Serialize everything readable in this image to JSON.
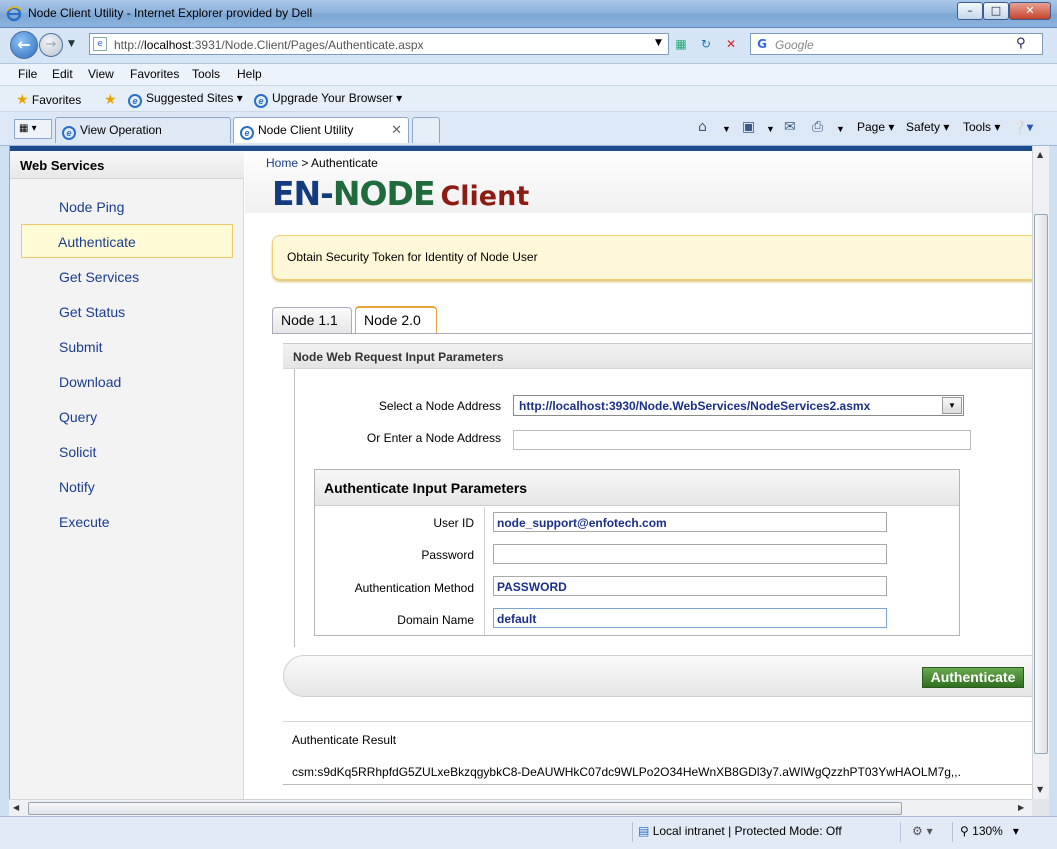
{
  "window": {
    "title": "Node Client Utility - Internet Explorer provided by Dell",
    "minimize": "–",
    "maximize": "□",
    "close": "✕"
  },
  "navbar": {
    "url_prefix": "http://",
    "url_host": "localhost",
    "url_rest": ":3931/Node.Client/Pages/Authenticate.aspx",
    "search_placeholder": "Google"
  },
  "menu": [
    "File",
    "Edit",
    "View",
    "Favorites",
    "Tools",
    "Help"
  ],
  "favorites_bar": {
    "favorites": "Favorites",
    "suggested": "Suggested Sites",
    "upgrade": "Upgrade Your Browser"
  },
  "browser_tabs": [
    {
      "label": "View Operation"
    },
    {
      "label": "Node Client Utility"
    }
  ],
  "command_bar": {
    "page": "Page",
    "safety": "Safety",
    "tools": "Tools"
  },
  "sidebar": {
    "title": "Web Services",
    "items": [
      "Node Ping",
      "Authenticate",
      "Get Services",
      "Get Status",
      "Submit",
      "Download",
      "Query",
      "Solicit",
      "Notify",
      "Execute"
    ],
    "active": "Authenticate"
  },
  "breadcrumb": {
    "home": "Home",
    "separator": ">",
    "current": "Authenticate"
  },
  "logo": {
    "en": "EN",
    "dash": "-",
    "node": "NODE",
    "client": "Client"
  },
  "banner": "Obtain Security Token for Identity of Node User",
  "page_tabs": [
    "Node 1.1",
    "Node 2.0"
  ],
  "active_page_tab": "Node 2.0",
  "request_panel": {
    "title": "Node Web Request Input Parameters",
    "select_label": "Select a Node Address",
    "select_value": "http://localhost:3930/Node.WebServices/NodeServices2.asmx",
    "enter_label": "Or Enter a Node Address",
    "enter_value": ""
  },
  "auth": {
    "title": "Authenticate Input Parameters",
    "user_id_label": "User ID",
    "user_id": "node_support@enfotech.com",
    "password_label": "Password",
    "password": "",
    "method_label": "Authentication Method",
    "method": "PASSWORD",
    "domain_label": "Domain Name",
    "domain": "default",
    "button": "Authenticate"
  },
  "result": {
    "title": "Authenticate Result",
    "value": "csm:s9dKq5RRhpfdG5ZULxeBkzqgybkC8-DeAUWHkC07dc9WLPo2O34HeWnXB8GDl3y7.aWIWgQzzhPT03YwHAOLM7g,,."
  },
  "status": {
    "zone": "Local intranet | Protected Mode: Off",
    "zoom": "130%"
  }
}
